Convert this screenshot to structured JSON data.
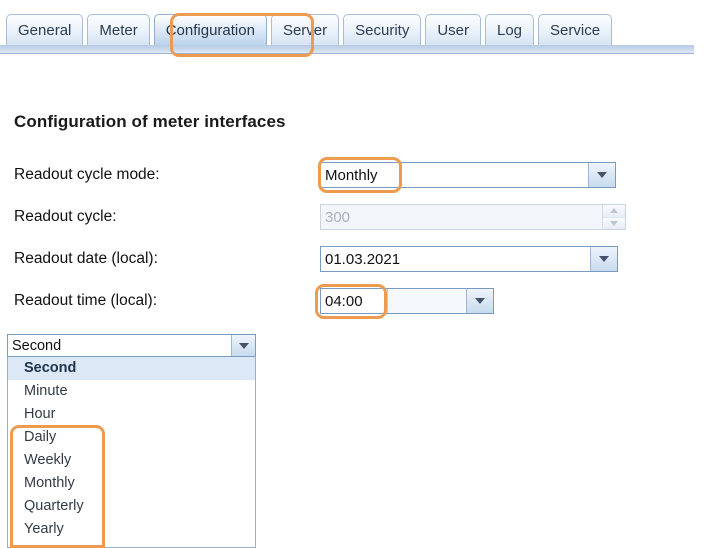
{
  "tabs": [
    {
      "label": "General",
      "active": false
    },
    {
      "label": "Meter",
      "active": false
    },
    {
      "label": "Configuration",
      "active": true
    },
    {
      "label": "Server",
      "active": false
    },
    {
      "label": "Security",
      "active": false
    },
    {
      "label": "User",
      "active": false
    },
    {
      "label": "Log",
      "active": false
    },
    {
      "label": "Service",
      "active": false
    }
  ],
  "heading": "Configuration of meter interfaces",
  "form": {
    "readout_cycle_mode": {
      "label": "Readout cycle mode:",
      "value": "Monthly"
    },
    "readout_cycle": {
      "label": "Readout cycle:",
      "value": "300",
      "disabled": true
    },
    "readout_date": {
      "label": "Readout date (local):",
      "value": "01.03.2021"
    },
    "readout_time": {
      "label": "Readout time (local):",
      "value": "04:00"
    }
  },
  "open_dropdown": {
    "selected": "Second",
    "options": [
      "Second",
      "Minute",
      "Hour",
      "Daily",
      "Weekly",
      "Monthly",
      "Quarterly",
      "Yearly"
    ]
  },
  "colors": {
    "annotation": "#ee9a4f",
    "tab_border": "#a8bdd8",
    "field_border": "#7a9bc0",
    "list_highlight": "#dce8f6",
    "disabled_text": "#a8b2bf"
  },
  "icons": {
    "caret_down": "chevron-down-icon",
    "spinner_up": "spinner-up-icon",
    "spinner_down": "spinner-down-icon"
  }
}
